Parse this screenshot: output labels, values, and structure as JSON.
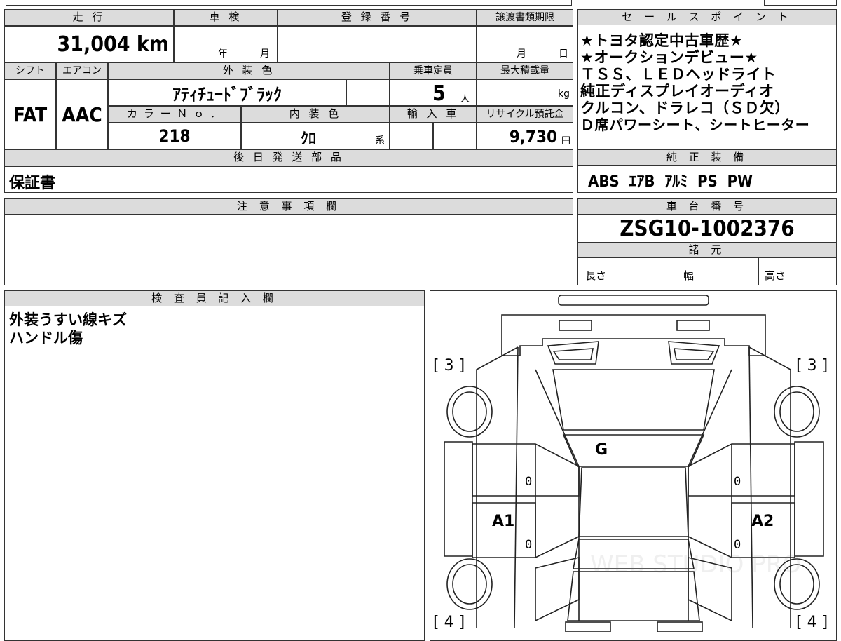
{
  "top": {
    "mileage_header": "走 行",
    "mileage_value": "31,004 km",
    "inspection_header": "車 検",
    "inspection_year": "年",
    "inspection_month": "月",
    "registration_header": "登 録 番 号",
    "transfer_header": "譲渡書類期限",
    "transfer_month": "月",
    "transfer_day": "日",
    "shift_header": "シフト",
    "ac_header": "エアコン",
    "exterior_color_header": "外 装 色",
    "capacity_header": "乗車定員",
    "max_load_header": "最大積載量",
    "shift_value": "FAT",
    "ac_value": "AAC",
    "exterior_color_value": "ｱﾃｨﾁｭｰﾄﾞﾌﾞﾗｯｸ",
    "capacity_value": "5",
    "capacity_unit": "人",
    "load_unit": "kg",
    "color_no_header": "カ ラ ー Ｎ ｏ ．",
    "interior_color_header": "内 装 色",
    "import_header": "輸 入 車",
    "recycle_header": "リサイクル預託金",
    "color_no_value": "218",
    "interior_color_value": "ｸﾛ",
    "interior_suffix": "系",
    "recycle_value": "9,730",
    "recycle_unit": "円",
    "later_parts_header": "後 日 発 送 部 品",
    "later_parts_value": "保証書"
  },
  "sales": {
    "header": "セ ー ル ス ポ イ ン ト",
    "lines": [
      "★トヨタ認定中古車歴★",
      "★オークションデビュー★",
      "ＴＳＳ、ＬＥＤヘッドライト",
      "純正ディスプレイオーディオ",
      "クルコン、ドラレコ（ＳＤ欠）",
      "Ｄ席パワーシート、シートヒーター"
    ]
  },
  "equipment": {
    "header": "純 正 装 備",
    "value": "ABS  ｴｱB  ｱﾙﾐ  PS  PW"
  },
  "notes": {
    "header": "注 意 事 項 欄"
  },
  "chassis": {
    "header": "車 台 番 号",
    "value": "ZSG10-1002376",
    "specs_header": "諸 元",
    "length_label": "長さ",
    "width_label": "幅",
    "height_label": "高さ"
  },
  "inspector": {
    "header": "検 査 員 記 入 欄",
    "lines": [
      "外装うすい線キズ",
      "ハンドル傷"
    ]
  },
  "diagram": {
    "tl": "[ 3 ]",
    "tr": "[ 3 ]",
    "bl": "[ 4 ]",
    "br": "[ 4 ]",
    "g": "G",
    "a1": "A1",
    "a2": "A2",
    "zero": "0",
    "watermark": "WEB STUDIO PRO"
  }
}
